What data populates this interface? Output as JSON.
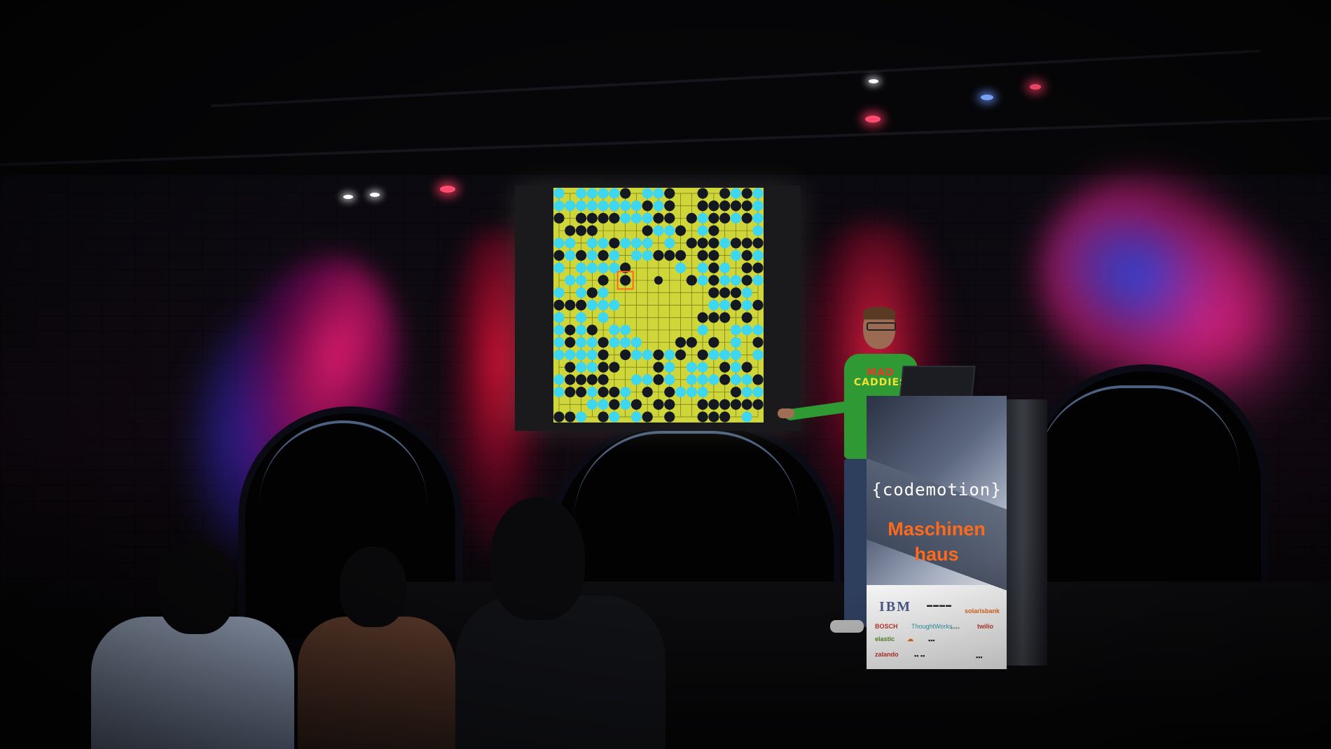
{
  "podium": {
    "brand": "{codemotion}",
    "venue_line1": "Maschinen",
    "venue_line2": "haus"
  },
  "shirt": {
    "line1": "MAD",
    "line2": "CADDIES"
  },
  "sponsors": {
    "ibm": "IBM",
    "bosch": "BOSCH",
    "thoughtworks": "ThoughtWorks",
    "zalando": "zalando",
    "solarisbank": "solarisbank",
    "elastic": "elastic",
    "twilio": "twilio"
  },
  "colors": {
    "board": "#cfd63a",
    "stone_light": "#3fd6f0",
    "stone_dark": "#141821",
    "venue_orange": "#ff6a1a"
  }
}
